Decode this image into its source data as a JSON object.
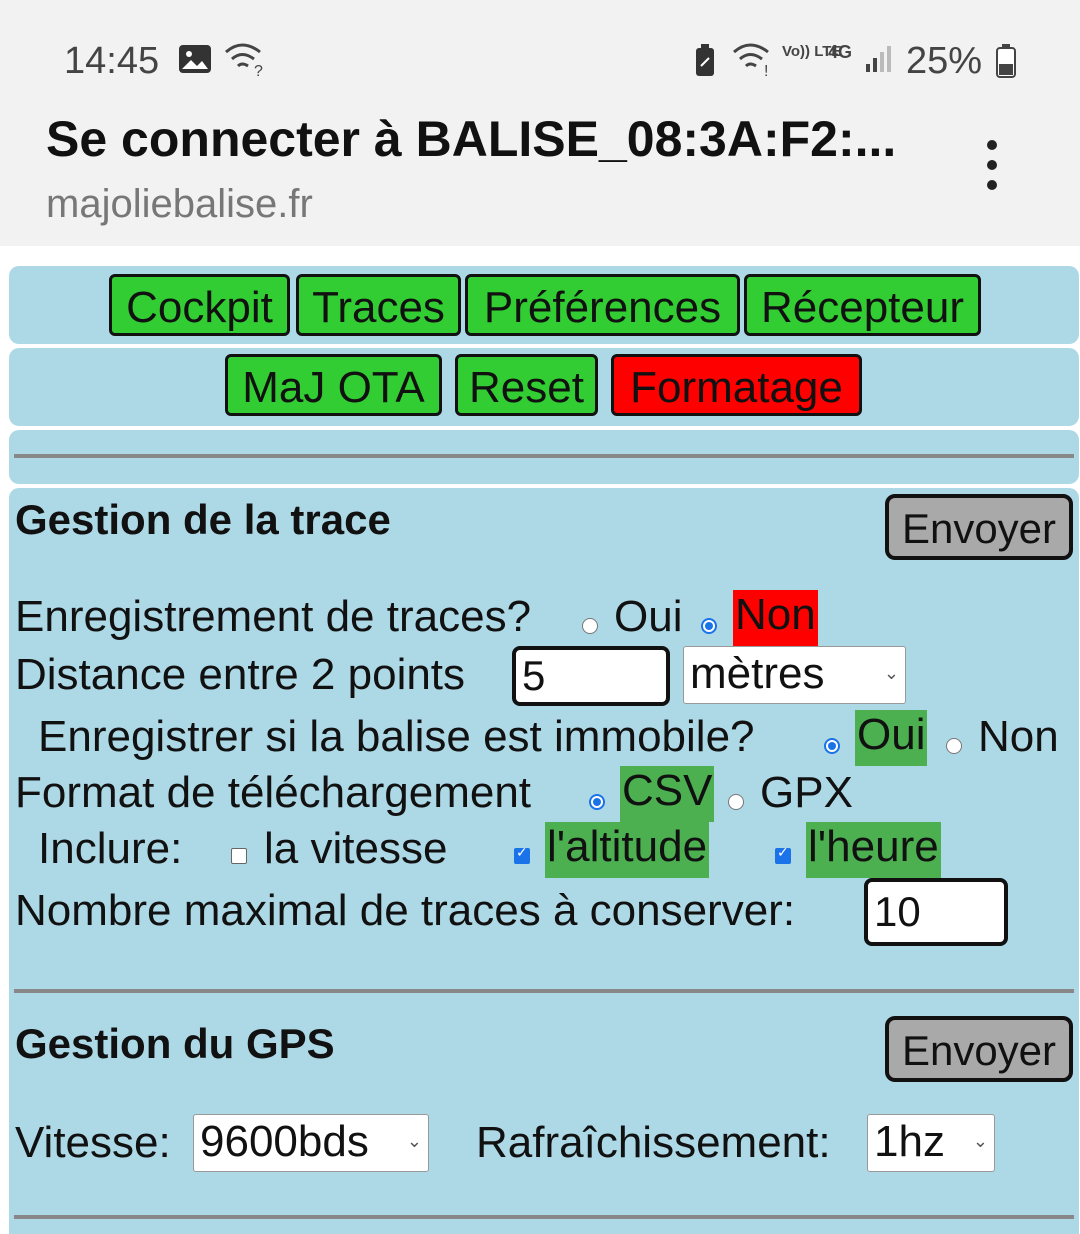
{
  "status_bar": {
    "time": "14:45",
    "icons": [
      "image-icon",
      "wifi-question-icon",
      "battery-saver-icon",
      "wifi-calling-icon",
      "volte-icon",
      "4g-icon",
      "signal-icon"
    ],
    "volte_label": "Vo)) LTE",
    "network_label": "4G",
    "battery": "25%"
  },
  "app_bar": {
    "title": "Se connecter à BALISE_08:3A:F2:...",
    "url": "majoliebalise.fr"
  },
  "nav": {
    "row1": [
      "Cockpit",
      "Traces",
      "Préférences",
      "Récepteur"
    ],
    "row2": [
      "MaJ OTA",
      "Reset",
      "Formatage"
    ]
  },
  "trace": {
    "heading": "Gestion de la trace",
    "send_label": "Envoyer",
    "record_label": "Enregistrement de traces?",
    "record_oui": "Oui",
    "record_non": "Non",
    "record_selected": "Non",
    "distance_label": "Distance entre 2 points",
    "distance_value": "5",
    "distance_unit": "mètres",
    "immobile_label": "Enregistrer si la balise est immobile?",
    "immobile_oui": "Oui",
    "immobile_non": "Non",
    "immobile_selected": "Oui",
    "format_label": "Format de téléchargement",
    "format_csv": "CSV",
    "format_gpx": "GPX",
    "format_selected": "CSV",
    "include_label": "Inclure:",
    "include_speed": "la vitesse",
    "include_speed_checked": false,
    "include_altitude": "l'altitude",
    "include_altitude_checked": true,
    "include_time": "l'heure",
    "include_time_checked": true,
    "max_traces_label": "Nombre maximal de traces à conserver:",
    "max_traces_value": "10"
  },
  "gps": {
    "heading": "Gestion du GPS",
    "send_label": "Envoyer",
    "speed_label": "Vitesse:",
    "speed_value": "9600bds",
    "refresh_label": "Rafraîchissement:",
    "refresh_value": "1hz"
  },
  "colors": {
    "panel": "#add8e6",
    "nav_button": "#32cd32",
    "danger_button": "#ff0000",
    "send_button": "#a9a9a9",
    "selected_green": "#4caf50",
    "selected_red": "#ff0000"
  }
}
